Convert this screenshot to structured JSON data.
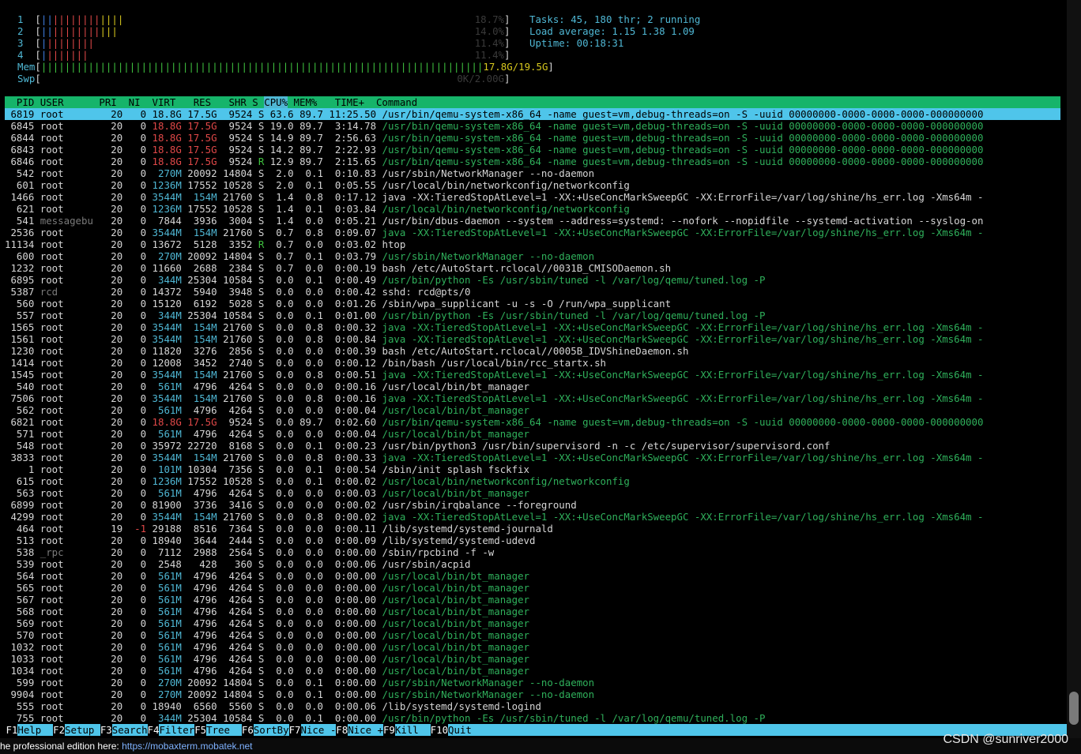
{
  "meters": {
    "cpus": [
      {
        "label": "1",
        "value": "18.7%"
      },
      {
        "label": "2",
        "value": "14.0%"
      },
      {
        "label": "3",
        "value": "11.4%"
      },
      {
        "label": "4",
        "value": "11.4%"
      }
    ],
    "mem": {
      "label": "Mem",
      "value": "17.8G/19.5G"
    },
    "swp": {
      "label": "Swp",
      "value": "0K/2.00G"
    }
  },
  "summary": {
    "tasks": "Tasks: 45, 180 thr; 2 running",
    "load": "Load average: 1.15 1.38 1.09",
    "uptime": "Uptime: 00:18:31"
  },
  "header": {
    "pre": "  PID USER      PRI  NI  VIRT   RES   SHR S ",
    "sort": "CPU%",
    "post": " MEM%   TIME+  Command"
  },
  "processes": [
    {
      "pid": "6819",
      "user": "root",
      "pri": "20",
      "ni": "0",
      "virt": "18.8G",
      "res": "17.5G",
      "shr": "9524",
      "s": "S",
      "cpu": "63.6",
      "mem": "89.7",
      "time": "11:25.50",
      "cmd": "/usr/bin/qemu-system-x86_64 -name guest=vm,debug-threads=on -S -uuid 00000000-0000-0000-0000-000000000"
    },
    {
      "pid": "6845",
      "user": "root",
      "pri": "20",
      "ni": "0",
      "virt": "18.8G",
      "res": "17.5G",
      "shr": "9524",
      "s": "S",
      "cpu": "19.0",
      "mem": "89.7",
      "time": "3:14.78",
      "cmd": "/usr/bin/qemu-system-x86_64 -name guest=vm,debug-threads=on -S -uuid 00000000-0000-0000-0000-000000000"
    },
    {
      "pid": "6844",
      "user": "root",
      "pri": "20",
      "ni": "0",
      "virt": "18.8G",
      "res": "17.5G",
      "shr": "9524",
      "s": "S",
      "cpu": "14.9",
      "mem": "89.7",
      "time": "2:56.63",
      "cmd": "/usr/bin/qemu-system-x86_64 -name guest=vm,debug-threads=on -S -uuid 00000000-0000-0000-0000-000000000"
    },
    {
      "pid": "6843",
      "user": "root",
      "pri": "20",
      "ni": "0",
      "virt": "18.8G",
      "res": "17.5G",
      "shr": "9524",
      "s": "S",
      "cpu": "14.2",
      "mem": "89.7",
      "time": "2:22.93",
      "cmd": "/usr/bin/qemu-system-x86_64 -name guest=vm,debug-threads=on -S -uuid 00000000-0000-0000-0000-000000000"
    },
    {
      "pid": "6846",
      "user": "root",
      "pri": "20",
      "ni": "0",
      "virt": "18.8G",
      "res": "17.5G",
      "shr": "9524",
      "s": "R",
      "cpu": "12.9",
      "mem": "89.7",
      "time": "2:15.65",
      "cmd": "/usr/bin/qemu-system-x86_64 -name guest=vm,debug-threads=on -S -uuid 00000000-0000-0000-0000-000000000"
    },
    {
      "pid": "542",
      "user": "root",
      "pri": "20",
      "ni": "0",
      "virt": "270M",
      "res": "20092",
      "shr": "14804",
      "s": "S",
      "cpu": "2.0",
      "mem": "0.1",
      "time": "0:10.83",
      "cmd": "/usr/sbin/NetworkManager --no-daemon"
    },
    {
      "pid": "601",
      "user": "root",
      "pri": "20",
      "ni": "0",
      "virt": "1236M",
      "res": "17552",
      "shr": "10528",
      "s": "S",
      "cpu": "2.0",
      "mem": "0.1",
      "time": "0:05.55",
      "cmd": "/usr/local/bin/networkconfig/networkconfig"
    },
    {
      "pid": "1466",
      "user": "root",
      "pri": "20",
      "ni": "0",
      "virt": "3544M",
      "res": "154M",
      "shr": "21760",
      "s": "S",
      "cpu": "1.4",
      "mem": "0.8",
      "time": "0:17.12",
      "cmd": "java -XX:TieredStopAtLevel=1 -XX:+UseConcMarkSweepGC -XX:ErrorFile=/var/log/shine/hs_err.log -Xms64m -"
    },
    {
      "pid": "621",
      "user": "root",
      "pri": "20",
      "ni": "0",
      "virt": "1236M",
      "res": "17552",
      "shr": "10528",
      "s": "S",
      "cpu": "1.4",
      "mem": "0.1",
      "time": "0:03.84",
      "cmd": "/usr/local/bin/networkconfig/networkconfig"
    },
    {
      "pid": "541",
      "user": "messagebu",
      "pri": "20",
      "ni": "0",
      "virt": "7844",
      "res": "3936",
      "shr": "3004",
      "s": "S",
      "cpu": "1.4",
      "mem": "0.0",
      "time": "0:05.21",
      "cmd": "/usr/bin/dbus-daemon --system --address=systemd: --nofork --nopidfile --systemd-activation --syslog-on"
    },
    {
      "pid": "2536",
      "user": "root",
      "pri": "20",
      "ni": "0",
      "virt": "3544M",
      "res": "154M",
      "shr": "21760",
      "s": "S",
      "cpu": "0.7",
      "mem": "0.8",
      "time": "0:09.07",
      "cmd": "java -XX:TieredStopAtLevel=1 -XX:+UseConcMarkSweepGC -XX:ErrorFile=/var/log/shine/hs_err.log -Xms64m -"
    },
    {
      "pid": "11134",
      "user": "root",
      "pri": "20",
      "ni": "0",
      "virt": "13672",
      "res": "5128",
      "shr": "3352",
      "s": "R",
      "cpu": "0.7",
      "mem": "0.0",
      "time": "0:03.02",
      "cmd": "htop"
    },
    {
      "pid": "600",
      "user": "root",
      "pri": "20",
      "ni": "0",
      "virt": "270M",
      "res": "20092",
      "shr": "14804",
      "s": "S",
      "cpu": "0.7",
      "mem": "0.1",
      "time": "0:03.79",
      "cmd": "/usr/sbin/NetworkManager --no-daemon"
    },
    {
      "pid": "1232",
      "user": "root",
      "pri": "20",
      "ni": "0",
      "virt": "11660",
      "res": "2688",
      "shr": "2384",
      "s": "S",
      "cpu": "0.7",
      "mem": "0.0",
      "time": "0:00.19",
      "cmd": "bash /etc/AutoStart.rclocal//0031B_CMISODaemon.sh"
    },
    {
      "pid": "6895",
      "user": "root",
      "pri": "20",
      "ni": "0",
      "virt": "344M",
      "res": "25304",
      "shr": "10584",
      "s": "S",
      "cpu": "0.0",
      "mem": "0.1",
      "time": "0:00.49",
      "cmd": "/usr/bin/python -Es /usr/sbin/tuned -l /var/log/qemu/tuned.log -P"
    },
    {
      "pid": "5387",
      "user": "rcd",
      "pri": "20",
      "ni": "0",
      "virt": "14372",
      "res": "5940",
      "shr": "3948",
      "s": "S",
      "cpu": "0.0",
      "mem": "0.0",
      "time": "0:00.42",
      "cmd": "sshd: rcd@pts/0"
    },
    {
      "pid": "560",
      "user": "root",
      "pri": "20",
      "ni": "0",
      "virt": "15120",
      "res": "6192",
      "shr": "5028",
      "s": "S",
      "cpu": "0.0",
      "mem": "0.0",
      "time": "0:01.26",
      "cmd": "/sbin/wpa_supplicant -u -s -O /run/wpa_supplicant"
    },
    {
      "pid": "557",
      "user": "root",
      "pri": "20",
      "ni": "0",
      "virt": "344M",
      "res": "25304",
      "shr": "10584",
      "s": "S",
      "cpu": "0.0",
      "mem": "0.1",
      "time": "0:01.00",
      "cmd": "/usr/bin/python -Es /usr/sbin/tuned -l /var/log/qemu/tuned.log -P"
    },
    {
      "pid": "1565",
      "user": "root",
      "pri": "20",
      "ni": "0",
      "virt": "3544M",
      "res": "154M",
      "shr": "21760",
      "s": "S",
      "cpu": "0.0",
      "mem": "0.8",
      "time": "0:00.32",
      "cmd": "java -XX:TieredStopAtLevel=1 -XX:+UseConcMarkSweepGC -XX:ErrorFile=/var/log/shine/hs_err.log -Xms64m -"
    },
    {
      "pid": "1561",
      "user": "root",
      "pri": "20",
      "ni": "0",
      "virt": "3544M",
      "res": "154M",
      "shr": "21760",
      "s": "S",
      "cpu": "0.0",
      "mem": "0.8",
      "time": "0:00.84",
      "cmd": "java -XX:TieredStopAtLevel=1 -XX:+UseConcMarkSweepGC -XX:ErrorFile=/var/log/shine/hs_err.log -Xms64m -"
    },
    {
      "pid": "1230",
      "user": "root",
      "pri": "20",
      "ni": "0",
      "virt": "11820",
      "res": "3276",
      "shr": "2856",
      "s": "S",
      "cpu": "0.0",
      "mem": "0.0",
      "time": "0:00.39",
      "cmd": "bash /etc/AutoStart.rclocal//0005B_IDVShineDaemon.sh"
    },
    {
      "pid": "1414",
      "user": "root",
      "pri": "20",
      "ni": "0",
      "virt": "12008",
      "res": "3452",
      "shr": "2740",
      "s": "S",
      "cpu": "0.0",
      "mem": "0.0",
      "time": "0:00.12",
      "cmd": "/bin/bash /usr/local/bin/rcc_startx.sh"
    },
    {
      "pid": "1545",
      "user": "root",
      "pri": "20",
      "ni": "0",
      "virt": "3544M",
      "res": "154M",
      "shr": "21760",
      "s": "S",
      "cpu": "0.0",
      "mem": "0.8",
      "time": "0:00.51",
      "cmd": "java -XX:TieredStopAtLevel=1 -XX:+UseConcMarkSweepGC -XX:ErrorFile=/var/log/shine/hs_err.log -Xms64m -"
    },
    {
      "pid": "540",
      "user": "root",
      "pri": "20",
      "ni": "0",
      "virt": "561M",
      "res": "4796",
      "shr": "4264",
      "s": "S",
      "cpu": "0.0",
      "mem": "0.0",
      "time": "0:00.16",
      "cmd": "/usr/local/bin/bt_manager"
    },
    {
      "pid": "7506",
      "user": "root",
      "pri": "20",
      "ni": "0",
      "virt": "3544M",
      "res": "154M",
      "shr": "21760",
      "s": "S",
      "cpu": "0.0",
      "mem": "0.8",
      "time": "0:00.16",
      "cmd": "java -XX:TieredStopAtLevel=1 -XX:+UseConcMarkSweepGC -XX:ErrorFile=/var/log/shine/hs_err.log -Xms64m -"
    },
    {
      "pid": "562",
      "user": "root",
      "pri": "20",
      "ni": "0",
      "virt": "561M",
      "res": "4796",
      "shr": "4264",
      "s": "S",
      "cpu": "0.0",
      "mem": "0.0",
      "time": "0:00.04",
      "cmd": "/usr/local/bin/bt_manager"
    },
    {
      "pid": "6821",
      "user": "root",
      "pri": "20",
      "ni": "0",
      "virt": "18.8G",
      "res": "17.5G",
      "shr": "9524",
      "s": "S",
      "cpu": "0.0",
      "mem": "89.7",
      "time": "0:02.60",
      "cmd": "/usr/bin/qemu-system-x86_64 -name guest=vm,debug-threads=on -S -uuid 00000000-0000-0000-0000-000000000"
    },
    {
      "pid": "571",
      "user": "root",
      "pri": "20",
      "ni": "0",
      "virt": "561M",
      "res": "4796",
      "shr": "4264",
      "s": "S",
      "cpu": "0.0",
      "mem": "0.0",
      "time": "0:00.04",
      "cmd": "/usr/local/bin/bt_manager"
    },
    {
      "pid": "548",
      "user": "root",
      "pri": "20",
      "ni": "0",
      "virt": "35972",
      "res": "22720",
      "shr": "8168",
      "s": "S",
      "cpu": "0.0",
      "mem": "0.1",
      "time": "0:00.23",
      "cmd": "/usr/bin/python3 /usr/bin/supervisord -n -c /etc/supervisor/supervisord.conf"
    },
    {
      "pid": "3833",
      "user": "root",
      "pri": "20",
      "ni": "0",
      "virt": "3544M",
      "res": "154M",
      "shr": "21760",
      "s": "S",
      "cpu": "0.0",
      "mem": "0.8",
      "time": "0:00.33",
      "cmd": "java -XX:TieredStopAtLevel=1 -XX:+UseConcMarkSweepGC -XX:ErrorFile=/var/log/shine/hs_err.log -Xms64m -"
    },
    {
      "pid": "1",
      "user": "root",
      "pri": "20",
      "ni": "0",
      "virt": "101M",
      "res": "10304",
      "shr": "7356",
      "s": "S",
      "cpu": "0.0",
      "mem": "0.1",
      "time": "0:00.54",
      "cmd": "/sbin/init splash fsckfix"
    },
    {
      "pid": "615",
      "user": "root",
      "pri": "20",
      "ni": "0",
      "virt": "1236M",
      "res": "17552",
      "shr": "10528",
      "s": "S",
      "cpu": "0.0",
      "mem": "0.1",
      "time": "0:00.02",
      "cmd": "/usr/local/bin/networkconfig/networkconfig"
    },
    {
      "pid": "563",
      "user": "root",
      "pri": "20",
      "ni": "0",
      "virt": "561M",
      "res": "4796",
      "shr": "4264",
      "s": "S",
      "cpu": "0.0",
      "mem": "0.0",
      "time": "0:00.03",
      "cmd": "/usr/local/bin/bt_manager"
    },
    {
      "pid": "6899",
      "user": "root",
      "pri": "20",
      "ni": "0",
      "virt": "81900",
      "res": "3736",
      "shr": "3416",
      "s": "S",
      "cpu": "0.0",
      "mem": "0.0",
      "time": "0:00.02",
      "cmd": "/usr/sbin/irqbalance --foreground"
    },
    {
      "pid": "4299",
      "user": "root",
      "pri": "20",
      "ni": "0",
      "virt": "3544M",
      "res": "154M",
      "shr": "21760",
      "s": "S",
      "cpu": "0.0",
      "mem": "0.8",
      "time": "0:00.02",
      "cmd": "java -XX:TieredStopAtLevel=1 -XX:+UseConcMarkSweepGC -XX:ErrorFile=/var/log/shine/hs_err.log -Xms64m -"
    },
    {
      "pid": "464",
      "user": "root",
      "pri": "19",
      "ni": "-1",
      "virt": "29188",
      "res": "8516",
      "shr": "7364",
      "s": "S",
      "cpu": "0.0",
      "mem": "0.0",
      "time": "0:00.11",
      "cmd": "/lib/systemd/systemd-journald"
    },
    {
      "pid": "513",
      "user": "root",
      "pri": "20",
      "ni": "0",
      "virt": "18940",
      "res": "3644",
      "shr": "2444",
      "s": "S",
      "cpu": "0.0",
      "mem": "0.0",
      "time": "0:00.09",
      "cmd": "/lib/systemd/systemd-udevd"
    },
    {
      "pid": "538",
      "user": "_rpc",
      "pri": "20",
      "ni": "0",
      "virt": "7112",
      "res": "2988",
      "shr": "2564",
      "s": "S",
      "cpu": "0.0",
      "mem": "0.0",
      "time": "0:00.00",
      "cmd": "/sbin/rpcbind -f -w"
    },
    {
      "pid": "539",
      "user": "root",
      "pri": "20",
      "ni": "0",
      "virt": "2548",
      "res": "428",
      "shr": "360",
      "s": "S",
      "cpu": "0.0",
      "mem": "0.0",
      "time": "0:00.06",
      "cmd": "/usr/sbin/acpid"
    },
    {
      "pid": "564",
      "user": "root",
      "pri": "20",
      "ni": "0",
      "virt": "561M",
      "res": "4796",
      "shr": "4264",
      "s": "S",
      "cpu": "0.0",
      "mem": "0.0",
      "time": "0:00.00",
      "cmd": "/usr/local/bin/bt_manager"
    },
    {
      "pid": "565",
      "user": "root",
      "pri": "20",
      "ni": "0",
      "virt": "561M",
      "res": "4796",
      "shr": "4264",
      "s": "S",
      "cpu": "0.0",
      "mem": "0.0",
      "time": "0:00.00",
      "cmd": "/usr/local/bin/bt_manager"
    },
    {
      "pid": "567",
      "user": "root",
      "pri": "20",
      "ni": "0",
      "virt": "561M",
      "res": "4796",
      "shr": "4264",
      "s": "S",
      "cpu": "0.0",
      "mem": "0.0",
      "time": "0:00.00",
      "cmd": "/usr/local/bin/bt_manager"
    },
    {
      "pid": "568",
      "user": "root",
      "pri": "20",
      "ni": "0",
      "virt": "561M",
      "res": "4796",
      "shr": "4264",
      "s": "S",
      "cpu": "0.0",
      "mem": "0.0",
      "time": "0:00.00",
      "cmd": "/usr/local/bin/bt_manager"
    },
    {
      "pid": "569",
      "user": "root",
      "pri": "20",
      "ni": "0",
      "virt": "561M",
      "res": "4796",
      "shr": "4264",
      "s": "S",
      "cpu": "0.0",
      "mem": "0.0",
      "time": "0:00.00",
      "cmd": "/usr/local/bin/bt_manager"
    },
    {
      "pid": "570",
      "user": "root",
      "pri": "20",
      "ni": "0",
      "virt": "561M",
      "res": "4796",
      "shr": "4264",
      "s": "S",
      "cpu": "0.0",
      "mem": "0.0",
      "time": "0:00.00",
      "cmd": "/usr/local/bin/bt_manager"
    },
    {
      "pid": "1032",
      "user": "root",
      "pri": "20",
      "ni": "0",
      "virt": "561M",
      "res": "4796",
      "shr": "4264",
      "s": "S",
      "cpu": "0.0",
      "mem": "0.0",
      "time": "0:00.00",
      "cmd": "/usr/local/bin/bt_manager"
    },
    {
      "pid": "1033",
      "user": "root",
      "pri": "20",
      "ni": "0",
      "virt": "561M",
      "res": "4796",
      "shr": "4264",
      "s": "S",
      "cpu": "0.0",
      "mem": "0.0",
      "time": "0:00.00",
      "cmd": "/usr/local/bin/bt_manager"
    },
    {
      "pid": "1034",
      "user": "root",
      "pri": "20",
      "ni": "0",
      "virt": "561M",
      "res": "4796",
      "shr": "4264",
      "s": "S",
      "cpu": "0.0",
      "mem": "0.0",
      "time": "0:00.00",
      "cmd": "/usr/local/bin/bt_manager"
    },
    {
      "pid": "599",
      "user": "root",
      "pri": "20",
      "ni": "0",
      "virt": "270M",
      "res": "20092",
      "shr": "14804",
      "s": "S",
      "cpu": "0.0",
      "mem": "0.1",
      "time": "0:00.00",
      "cmd": "/usr/sbin/NetworkManager --no-daemon"
    },
    {
      "pid": "9904",
      "user": "root",
      "pri": "20",
      "ni": "0",
      "virt": "270M",
      "res": "20092",
      "shr": "14804",
      "s": "S",
      "cpu": "0.0",
      "mem": "0.1",
      "time": "0:00.00",
      "cmd": "/usr/sbin/NetworkManager --no-daemon"
    },
    {
      "pid": "555",
      "user": "root",
      "pri": "20",
      "ni": "0",
      "virt": "18940",
      "res": "6560",
      "shr": "5560",
      "s": "S",
      "cpu": "0.0",
      "mem": "0.0",
      "time": "0:00.06",
      "cmd": "/lib/systemd/systemd-logind"
    },
    {
      "pid": "755",
      "user": "root",
      "pri": "20",
      "ni": "0",
      "virt": "344M",
      "res": "25304",
      "shr": "10584",
      "s": "S",
      "cpu": "0.0",
      "mem": "0.1",
      "time": "0:00.00",
      "cmd": "/usr/bin/python -Es /usr/sbin/tuned -l /var/log/qemu/tuned.log -P"
    }
  ],
  "thread_rows": [
    1,
    2,
    3,
    4,
    8,
    10,
    12,
    14,
    17,
    18,
    19,
    22,
    24,
    25,
    26,
    27,
    29,
    31,
    32,
    34,
    39,
    40,
    41,
    42,
    43,
    44,
    45,
    46,
    47,
    48,
    49,
    51
  ],
  "function_keys": [
    {
      "key": "F1",
      "label": "Help  "
    },
    {
      "key": "F2",
      "label": "Setup "
    },
    {
      "key": "F3",
      "label": "Search"
    },
    {
      "key": "F4",
      "label": "Filter"
    },
    {
      "key": "F5",
      "label": "Tree  "
    },
    {
      "key": "F6",
      "label": "SortBy"
    },
    {
      "key": "F7",
      "label": "Nice -"
    },
    {
      "key": "F8",
      "label": "Nice +"
    },
    {
      "key": "F9",
      "label": "Kill  "
    },
    {
      "key": "F10",
      "label": "Quit  "
    }
  ],
  "statusbar": {
    "text": "he professional edition here: ",
    "link": "https://mobaxterm.mobatek.net"
  },
  "watermark": "CSDN @sunriver2000",
  "colors": {
    "header_bg": "#16b46a",
    "selection_bg": "#4fc5ea",
    "thread_green": "#2fb05b",
    "accent_cyan": "#4fb7d4"
  }
}
